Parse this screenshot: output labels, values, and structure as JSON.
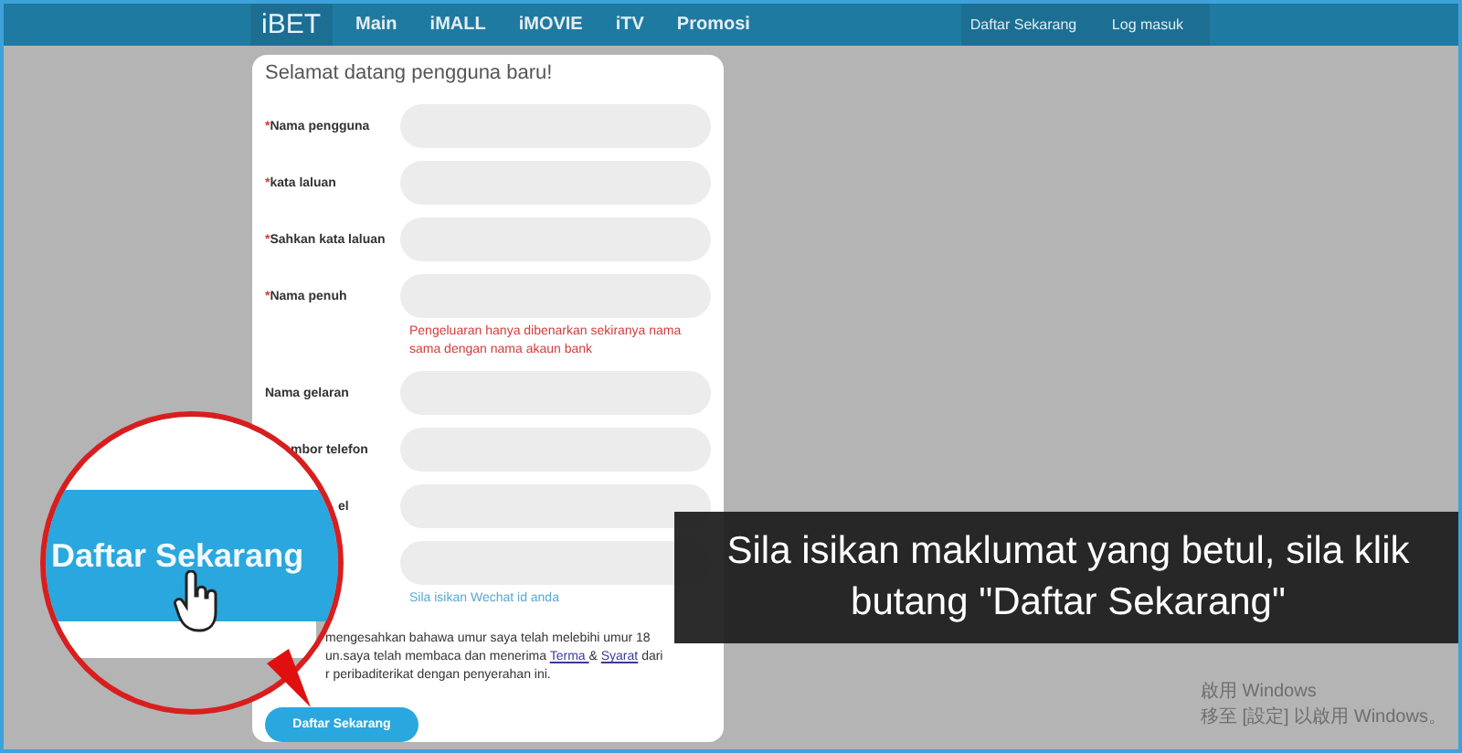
{
  "nav": {
    "logo": "iBET",
    "links": [
      "Main",
      "iMALL",
      "iMOVIE",
      "iTV",
      "Promosi"
    ],
    "actions": [
      "Daftar Sekarang",
      "Log masuk"
    ]
  },
  "form": {
    "title": "Selamat datang pengguna baru!",
    "fields": [
      {
        "mark": "*",
        "label": "Nama pengguna"
      },
      {
        "mark": "*",
        "label": "kata laluan"
      },
      {
        "mark": "*",
        "label": "Sahkan kata laluan"
      },
      {
        "mark": "*",
        "label": "Nama penuh",
        "hint": "Pengeluaran hanya dibenarkan sekiranya nama sama dengan nama akaun bank",
        "error": true
      },
      {
        "label": "Nama gelaran"
      },
      {
        "label": "mbor telefon"
      },
      {
        "label": "el"
      },
      {
        "hint": "Sila isikan Wechat id anda",
        "error": false
      }
    ],
    "agreement": {
      "line_1": "mengesahkan bahawa umur saya telah melebihi umur 18",
      "line_2": "un.saya telah membaca dan menerima",
      "link_1": "Terma ",
      "joiner": "&",
      "link_2": "Syarat",
      "line_2_end": "dari",
      "line_3": "r peribaditerikat dengan penyerahan ini."
    },
    "submit": "Daftar Sekarang"
  },
  "magnifier": {
    "text": "Daftar Sekarang"
  },
  "caption": "Sila isikan maklumat yang betul, sila klik butang \"Daftar Sekarang\"",
  "os_notice": {
    "title": "啟用 Windows",
    "detail": "移至 [設定] 以啟用 Windows。"
  }
}
